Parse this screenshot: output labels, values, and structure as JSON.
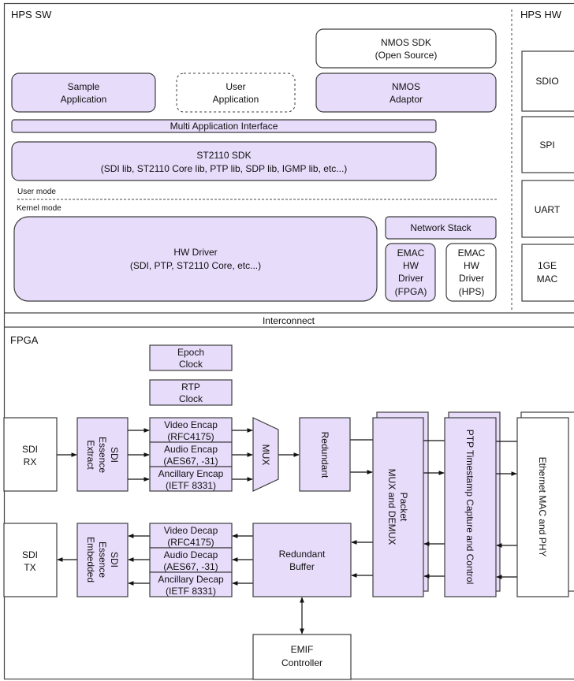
{
  "colors": {
    "block_fill": "#e8dcfb",
    "border": "#3c3c3c"
  },
  "hps_sw": {
    "title": "HPS SW",
    "nmos_sdk": [
      "NMOS SDK",
      "(Open Source)"
    ],
    "sample_app": [
      "Sample",
      "Application"
    ],
    "user_app": [
      "User",
      "Application"
    ],
    "nmos_adaptor": [
      "NMOS",
      "Adaptor"
    ],
    "multi_app_interface": "Multi Application Interface",
    "st2110_sdk": [
      "ST2110 SDK",
      "(SDI lib, ST2110 Core lib, PTP lib, SDP lib, IGMP lib, etc...)"
    ],
    "user_mode": "User mode",
    "kernel_mode": "Kernel mode",
    "hw_driver": [
      "HW Driver",
      "(SDI, PTP, ST2110 Core, etc...)"
    ],
    "network_stack": "Network Stack",
    "emac_fpga": [
      "EMAC",
      "HW",
      "Driver",
      "(FPGA)"
    ],
    "emac_hps": [
      "EMAC",
      "HW",
      "Driver",
      "(HPS)"
    ]
  },
  "hps_hw": {
    "title": "HPS HW",
    "items": [
      "SDIO",
      "SPI",
      "UART",
      [
        "1GE",
        "MAC"
      ]
    ]
  },
  "interconnect": "Interconnect",
  "fpga": {
    "title": "FPGA",
    "epoch_clock": [
      "Epoch",
      "Clock"
    ],
    "rtp_clock": [
      "RTP",
      "Clock"
    ],
    "sdi_rx": [
      "SDI",
      "RX"
    ],
    "sdi_extract": [
      "SDI",
      "Essence",
      "Extract"
    ],
    "encap": [
      [
        "Video Encap",
        "(RFC4175)"
      ],
      [
        "Audio Encap",
        "(AES67, -31)"
      ],
      [
        "Ancillary Encap",
        "(IETF 8331)"
      ]
    ],
    "mux": "MUX",
    "redundant": "Redundant",
    "packet": [
      "Packet",
      "MUX and DEMUX"
    ],
    "ptp": "PTP Timestamp Capture and Control",
    "ethernet": "Ethernet MAC and PHY",
    "sdi_tx": [
      "SDI",
      "TX"
    ],
    "sdi_embedded": [
      "SDI",
      "Essence",
      "Embedded"
    ],
    "decap": [
      [
        "Video Decap",
        "(RFC4175)"
      ],
      [
        "Audio Decap",
        "(AES67, -31)"
      ],
      [
        "Ancillary Decap",
        "(IETF 8331)"
      ]
    ],
    "redundant_buffer": [
      "Redundant",
      "Buffer"
    ],
    "emif": [
      "EMIF",
      "Controller"
    ]
  }
}
